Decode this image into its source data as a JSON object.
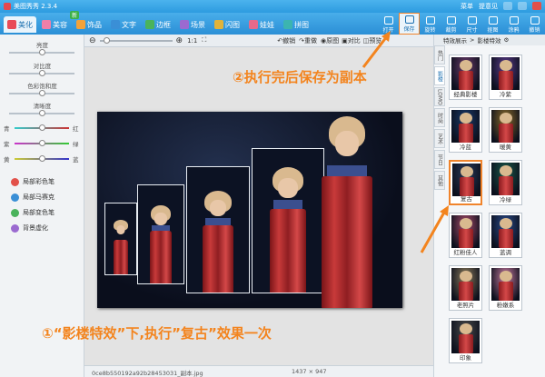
{
  "app": {
    "title": "美图秀秀 2.3.4",
    "menu": "菜单",
    "help": "提意见"
  },
  "tabs": [
    {
      "label": "美化",
      "color": "#e94b57"
    },
    {
      "label": "美容",
      "color": "#f07fa8"
    },
    {
      "label": "饰品",
      "color": "#f2a23a"
    },
    {
      "label": "文字",
      "color": "#3a8fd6"
    },
    {
      "label": "边框",
      "color": "#4ab35c"
    },
    {
      "label": "场景",
      "color": "#9b6ad0"
    },
    {
      "label": "闪图",
      "color": "#e0b33a"
    },
    {
      "label": "娃娃",
      "color": "#e86a8a"
    },
    {
      "label": "拼图",
      "color": "#3cb4b0"
    }
  ],
  "new_badge": "新",
  "right_tools": [
    {
      "label": "打开"
    },
    {
      "label": "保存"
    },
    {
      "label": "旋转"
    },
    {
      "label": "裁剪"
    },
    {
      "label": "尺寸"
    },
    {
      "label": "抠图"
    },
    {
      "label": "涂鸦"
    },
    {
      "label": "撤销"
    }
  ],
  "left": {
    "sliders": [
      "亮度",
      "对比度",
      "色彩饱和度",
      "清晰度"
    ],
    "color_sliders": [
      {
        "left": "青",
        "right": "红",
        "pos": 0.5
      },
      {
        "left": "紫",
        "right": "绿",
        "pos": 0.5
      },
      {
        "left": "黄",
        "right": "蓝",
        "pos": 0.5
      }
    ],
    "brushes": [
      {
        "label": "局部彩色笔",
        "color": "#e2514a"
      },
      {
        "label": "局部马赛克",
        "color": "#3a8fd6"
      },
      {
        "label": "局部变色笔",
        "color": "#4ab35c"
      },
      {
        "label": "背景虚化",
        "color": "#9b6ad0"
      }
    ]
  },
  "toolbar": {
    "zoom_ratio": "1:1",
    "undo": "撤销",
    "redo": "重做",
    "original": "原图",
    "compare": "对比",
    "preview": "预览"
  },
  "status": {
    "filename": "0ce8b550192a92b28453031_副本.jpg",
    "dimensions": "1437 × 947"
  },
  "right": {
    "tabs": [
      "特效展示",
      "影楼特效"
    ],
    "vtabs": [
      "热门",
      "影楼",
      "LOMO",
      "时尚",
      "艺术",
      "节日",
      "其他"
    ],
    "thumbs": [
      {
        "label": "经典影楼",
        "tint": "#6a3a6a"
      },
      {
        "label": "冷紫",
        "tint": "#5a3a8a"
      },
      {
        "label": "冷蓝",
        "tint": "#1a3a6a"
      },
      {
        "label": "暖黄",
        "tint": "#8a6a2a"
      },
      {
        "label": "复古",
        "tint": "#2a3a5a"
      },
      {
        "label": "冷绿",
        "tint": "#1a5a4a"
      },
      {
        "label": "红粉佳人",
        "tint": "#a84a6a"
      },
      {
        "label": "蓝调",
        "tint": "#2a4a8a"
      },
      {
        "label": "老照片",
        "tint": "#8a7a5a"
      },
      {
        "label": "粉嫩系",
        "tint": "#c87aa0"
      },
      {
        "label": "印象",
        "tint": "#4a4a4a"
      }
    ]
  },
  "annotations": {
    "step1": "①“影楼特效”下,执行”复古”效果一次",
    "step2": "②执行完后保存为副本"
  }
}
